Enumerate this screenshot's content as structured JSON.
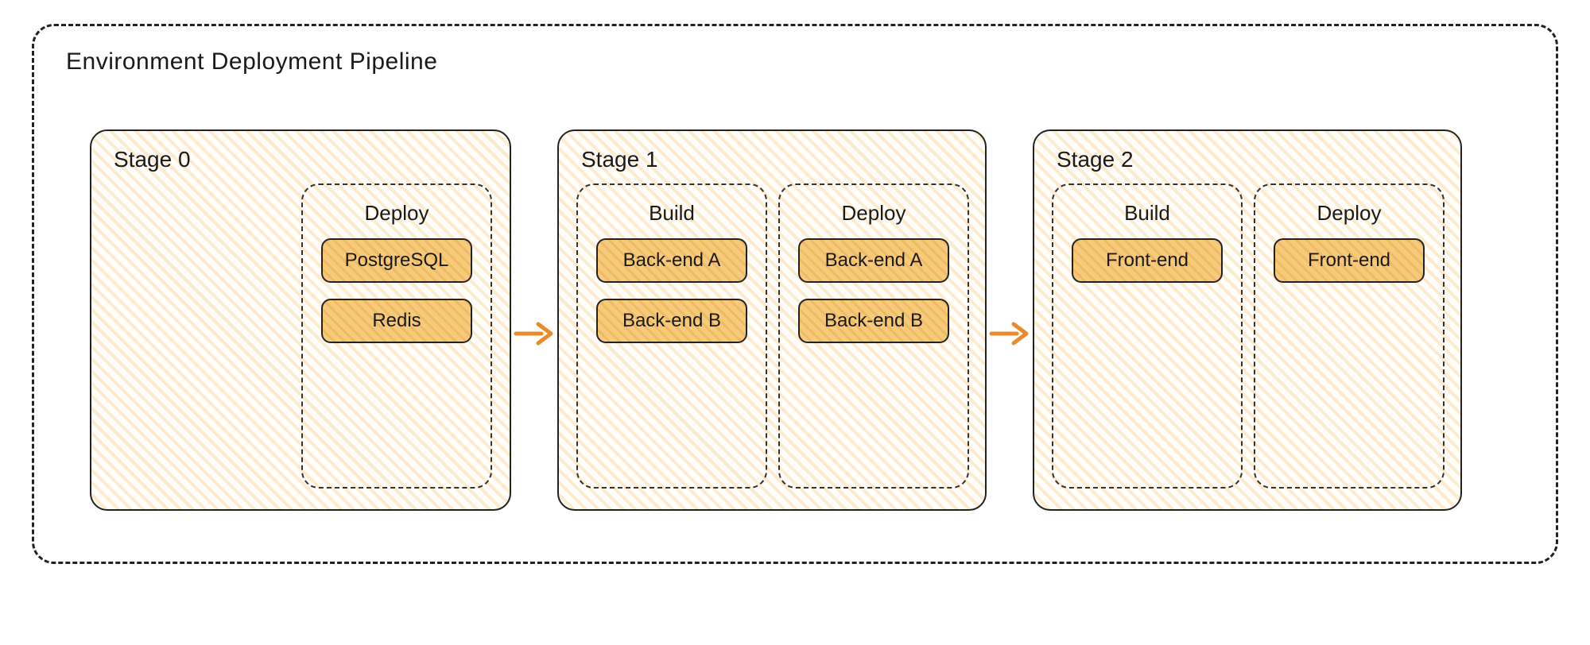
{
  "pipeline": {
    "title": "Environment Deployment Pipeline"
  },
  "stages": [
    {
      "title": "Stage 0",
      "phases": [
        {
          "title": "Deploy",
          "items": [
            "PostgreSQL",
            "Redis"
          ]
        }
      ]
    },
    {
      "title": "Stage 1",
      "phases": [
        {
          "title": "Build",
          "items": [
            "Back-end A",
            "Back-end B"
          ]
        },
        {
          "title": "Deploy",
          "items": [
            "Back-end A",
            "Back-end B"
          ]
        }
      ]
    },
    {
      "title": "Stage 2",
      "phases": [
        {
          "title": "Build",
          "items": [
            "Front-end"
          ]
        },
        {
          "title": "Deploy",
          "items": [
            "Front-end"
          ]
        }
      ]
    }
  ],
  "colors": {
    "arrow": "#e98b2a",
    "box_fill": "#f6c978",
    "stroke": "#222222"
  }
}
